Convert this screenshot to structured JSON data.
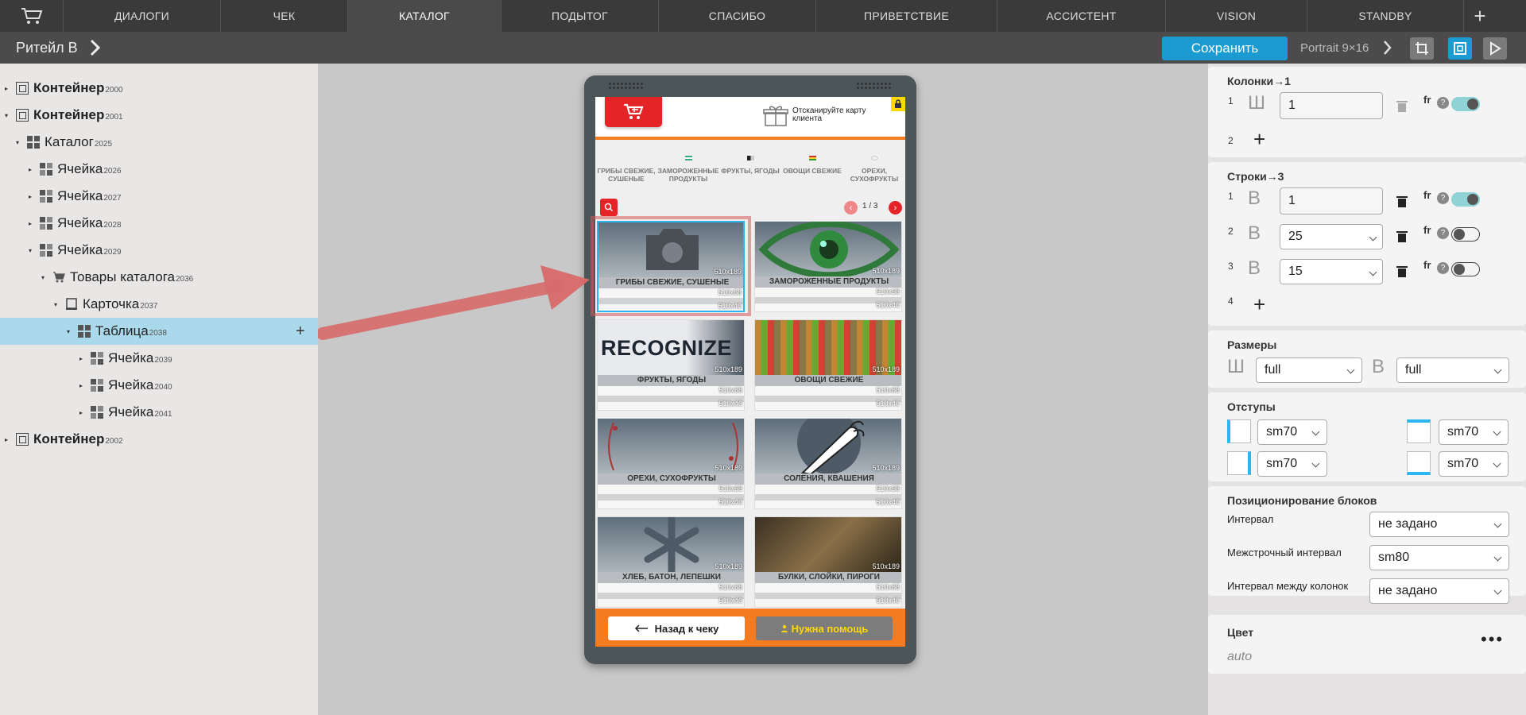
{
  "topbar": {
    "tabs": [
      {
        "label": "ДИАЛОГИ",
        "active": false
      },
      {
        "label": "ЧЕК",
        "active": false
      },
      {
        "label": "КАТАЛОГ",
        "active": true
      },
      {
        "label": "ПОДЫТОГ",
        "active": false
      },
      {
        "label": "СПАСИБО",
        "active": false
      },
      {
        "label": "ПРИВЕТСТВИЕ",
        "active": false
      },
      {
        "label": "АССИСТЕНТ",
        "active": false
      },
      {
        "label": "VISION",
        "active": false
      },
      {
        "label": "STANDBY",
        "active": false
      }
    ],
    "add_label": "+"
  },
  "toolbar": {
    "project": "Ритейл В",
    "save_label": "Сохранить",
    "orientation": "Portrait 9×16"
  },
  "tree": {
    "nodes": [
      {
        "label": "Контейнер",
        "id": "2000",
        "bold": true,
        "icon": "container-icon"
      },
      {
        "label": "Контейнер",
        "id": "2001",
        "bold": true,
        "icon": "container-icon"
      },
      {
        "label": "Каталог",
        "id": "2025",
        "bold": false,
        "icon": "grid-icon"
      },
      {
        "label": "Ячейка",
        "id": "2026",
        "bold": false,
        "icon": "cell-icon"
      },
      {
        "label": "Ячейка",
        "id": "2027",
        "bold": false,
        "icon": "cell-icon"
      },
      {
        "label": "Ячейка",
        "id": "2028",
        "bold": false,
        "icon": "cell-icon"
      },
      {
        "label": "Ячейка",
        "id": "2029",
        "bold": false,
        "icon": "cell-icon"
      },
      {
        "label": "Товары каталога",
        "id": "2036",
        "bold": false,
        "icon": "cart-icon"
      },
      {
        "label": "Карточка",
        "id": "2037",
        "bold": false,
        "icon": "card-icon"
      },
      {
        "label": "Таблица",
        "id": "2038",
        "bold": false,
        "icon": "grid-icon",
        "selected": true
      },
      {
        "label": "Ячейка",
        "id": "2039",
        "bold": false,
        "icon": "cell-icon"
      },
      {
        "label": "Ячейка",
        "id": "2040",
        "bold": false,
        "icon": "cell-icon"
      },
      {
        "label": "Ячейка",
        "id": "2041",
        "bold": false,
        "icon": "cell-icon"
      },
      {
        "label": "Контейнер",
        "id": "2002",
        "bold": true,
        "icon": "container-icon"
      }
    ],
    "add_label": "+"
  },
  "preview": {
    "scan_text": "Отсканируйте карту клиента",
    "categories": [
      "ГРИБЫ СВЕЖИЕ, СУШЕНЫЕ",
      "ЗАМОРОЖЕННЫЕ ПРОДУКТЫ",
      "ФРУКТЫ, ЯГОДЫ",
      "ОВОЩИ СВЕЖИЕ",
      "ОРЕХИ, СУХОФРУКТЫ"
    ],
    "page_indicator": "1 / 3",
    "size_labels": [
      "510x189",
      "510x68",
      "510x40"
    ],
    "products": [
      {
        "label": "ГРИБЫ СВЕЖИЕ, СУШЕНЫЕ",
        "image": "camera-icon"
      },
      {
        "label": "ЗАМОРОЖЕННЫЕ ПРОДУКТЫ",
        "image": "eye-icon"
      },
      {
        "label": "ФРУКТЫ, ЯГОДЫ",
        "image_text": "RECOGNIZE"
      },
      {
        "label": "ОВОЩИ СВЕЖИЕ",
        "image": "vegetables-photo"
      },
      {
        "label": "ОРЕХИ, СУХОФРУКТЫ",
        "image": "nuts-icon"
      },
      {
        "label": "СОЛЕНИЯ, КВАШЕНИЯ",
        "image": "carrot-icon"
      },
      {
        "label": "ХЛЕБ, БАТОН, ЛЕПЕШКИ",
        "image": "snowflake-icon"
      },
      {
        "label": "БУЛКИ, СЛОЙКИ, ПИРОГИ",
        "image": "bakery-photo"
      }
    ],
    "back_label": "Назад к чеку",
    "help_label": "Нужна помощь"
  },
  "panel": {
    "columns": {
      "title": "Колонки→1",
      "rows": [
        {
          "no": "1",
          "value": "1"
        }
      ],
      "next_no": "2"
    },
    "rows": {
      "title": "Строки→3",
      "rows": [
        {
          "no": "1",
          "value": "1"
        },
        {
          "no": "2",
          "value": "25"
        },
        {
          "no": "3",
          "value": "15"
        }
      ],
      "next_no": "4"
    },
    "sizes": {
      "title": "Размеры",
      "width": "full",
      "height": "full"
    },
    "padding": {
      "title": "Отступы",
      "values": [
        "sm70",
        "sm70",
        "sm70",
        "sm70"
      ]
    },
    "positioning": {
      "title": "Позиционирование блоков",
      "rows": [
        {
          "label": "Интервал",
          "value": "не задано"
        },
        {
          "label": "Межстрочный интервал",
          "value": "sm80"
        },
        {
          "label": "Интервал между колонок",
          "value": "не задано"
        }
      ]
    },
    "color": {
      "title": "Цвет",
      "value": "auto"
    },
    "fr_label": "fr",
    "letters": {
      "width": "Ш",
      "height": "В"
    }
  },
  "colors": {
    "accent": "#1b9bd1",
    "brand_red": "#e52428",
    "brand_orange": "#f47b20",
    "selection": "#a9d9ea",
    "arrow": "#d86a6a"
  }
}
